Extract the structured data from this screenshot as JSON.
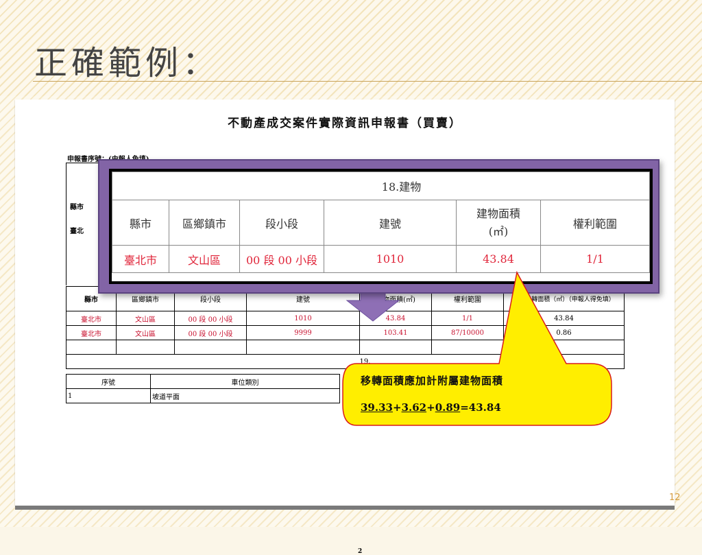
{
  "slide": {
    "title": "正確範例：",
    "page_number": "12"
  },
  "document": {
    "title": "不動產成交案件實際資訊申報書（買賣）",
    "subline": "申報書序號：(由報人免填)",
    "page_footer": "2",
    "left_labels": [
      "縣市",
      "臺北"
    ],
    "table19_label": "19.",
    "building_table": {
      "headers": [
        "縣市",
        "區鄉鎮市",
        "段小段",
        "建號",
        "建物面積(㎡)",
        "權利範圍",
        "建物移轉面積（㎡）（申報人得免填）"
      ],
      "rows": [
        [
          "臺北市",
          "文山區",
          "00 段 00 小段",
          "1010",
          "43.84",
          "1/1",
          "43.84"
        ],
        [
          "臺北市",
          "文山區",
          "00 段 00 小段",
          "9999",
          "103.41",
          "87/10000",
          "0.86"
        ]
      ]
    },
    "attached_table": {
      "headers": [
        "序號",
        "車位類別"
      ],
      "rows": [
        [
          "1",
          "坡道平面"
        ]
      ]
    }
  },
  "zoom": {
    "section_title": "18.建物",
    "headers": [
      "縣市",
      "區鄉鎮市",
      "段小段",
      "建號",
      "建物面積",
      "(㎡)",
      "權利範圍"
    ],
    "row": [
      "臺北市",
      "文山區",
      "00 段 00 小段",
      "1010",
      "43.84",
      "1/1"
    ]
  },
  "callout": {
    "line1": "移轉面積應加計附屬建物面積",
    "terms": [
      "39.33",
      "3.62",
      "0.89"
    ],
    "result": "=43.84"
  },
  "colors": {
    "title_text": "#444444",
    "accent_rule": "#c9a35a",
    "zoom_frame": "#8264a6",
    "arrow": "#8e6fb5",
    "callout_fill": "#ffee00",
    "callout_border": "#d81b1b",
    "red_text": "#c8102e"
  }
}
